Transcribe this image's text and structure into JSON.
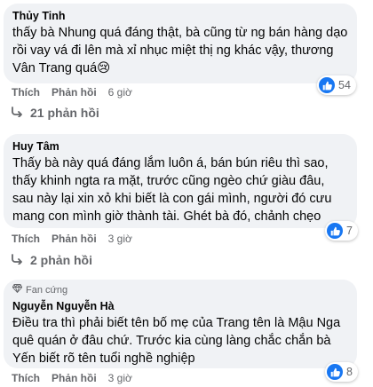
{
  "comments": [
    {
      "author": "Thủy Tinh",
      "text": "thấy bà Nhung quá đáng thật, bà cũng từ ng bán hàng dạo rồi vay vá đi lên mà xỉ nhục miệt thị ng khác vậy, thương Vân Trang quá😢",
      "like_label": "Thích",
      "reply_label": "Phản hồi",
      "time": "6 giờ",
      "reaction_count": "54",
      "replies_label": "21 phản hồi"
    },
    {
      "author": "Huy Tâm",
      "text": "Thấy bà này quá đáng lắm luôn á, bán bún riêu thì sao, thấy khinh ngta ra mặt, trước cũng ngèo chứ giàu đâu, sau này lại xin xỏ khi biết là con gái mình, người đó cưu mang con mình giờ thành tài. Ghét bà đó, chảnh chẹo",
      "like_label": "Thích",
      "reply_label": "Phản hồi",
      "time": "3 giờ",
      "reaction_count": "7",
      "replies_label": "2 phản hồi"
    },
    {
      "badge": "Fan cứng",
      "author": "Nguyễn Nguyễn Hà",
      "text": "Điều tra thì phải biết tên bố mẹ của Trang tên là Mậu Nga quê quán ở đâu chứ. Trước kia cùng làng chắc chắn bà Yến biết rõ tên tuổi nghề nghiệp",
      "like_label": "Thích",
      "reply_label": "Phản hồi",
      "time": "3 giờ",
      "reaction_count": "8"
    }
  ],
  "colors": {
    "bubble": "#f0f2f5",
    "like_blue": "#1877f2",
    "secondary_text": "#65676b"
  },
  "icons": {
    "like": "thumbs-up-icon",
    "reply_arrow": "reply-arrow-icon",
    "badge": "diamond-badge-icon"
  }
}
